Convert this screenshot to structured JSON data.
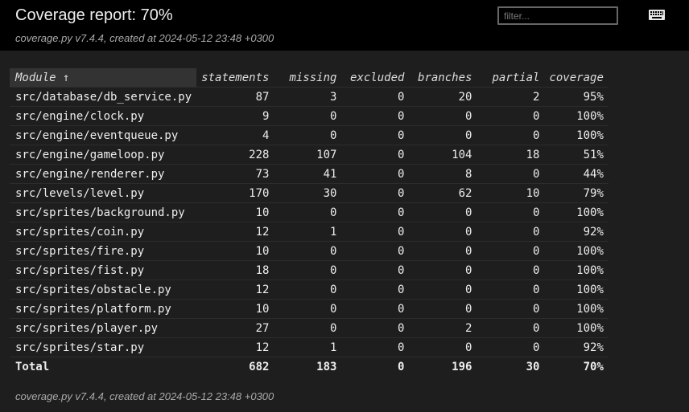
{
  "header": {
    "title": "Coverage report: 70%",
    "subtitle": "coverage.py v7.4.4, created at 2024-05-12 23:48 +0300",
    "filter_placeholder": "filter...",
    "keyboard_icon": "keyboard-icon"
  },
  "table": {
    "columns": [
      "Module ↑",
      "statements",
      "missing",
      "excluded",
      "branches",
      "partial",
      "coverage"
    ],
    "rows": [
      [
        "src/database/db_service.py",
        "87",
        "3",
        "0",
        "20",
        "2",
        "95%"
      ],
      [
        "src/engine/clock.py",
        "9",
        "0",
        "0",
        "0",
        "0",
        "100%"
      ],
      [
        "src/engine/eventqueue.py",
        "4",
        "0",
        "0",
        "0",
        "0",
        "100%"
      ],
      [
        "src/engine/gameloop.py",
        "228",
        "107",
        "0",
        "104",
        "18",
        "51%"
      ],
      [
        "src/engine/renderer.py",
        "73",
        "41",
        "0",
        "8",
        "0",
        "44%"
      ],
      [
        "src/levels/level.py",
        "170",
        "30",
        "0",
        "62",
        "10",
        "79%"
      ],
      [
        "src/sprites/background.py",
        "10",
        "0",
        "0",
        "0",
        "0",
        "100%"
      ],
      [
        "src/sprites/coin.py",
        "12",
        "1",
        "0",
        "0",
        "0",
        "92%"
      ],
      [
        "src/sprites/fire.py",
        "10",
        "0",
        "0",
        "0",
        "0",
        "100%"
      ],
      [
        "src/sprites/fist.py",
        "18",
        "0",
        "0",
        "0",
        "0",
        "100%"
      ],
      [
        "src/sprites/obstacle.py",
        "12",
        "0",
        "0",
        "0",
        "0",
        "100%"
      ],
      [
        "src/sprites/platform.py",
        "10",
        "0",
        "0",
        "0",
        "0",
        "100%"
      ],
      [
        "src/sprites/player.py",
        "27",
        "0",
        "0",
        "2",
        "0",
        "100%"
      ],
      [
        "src/sprites/star.py",
        "12",
        "1",
        "0",
        "0",
        "0",
        "92%"
      ]
    ],
    "total": [
      "Total",
      "682",
      "183",
      "0",
      "196",
      "30",
      "70%"
    ]
  },
  "footer": {
    "text": "coverage.py v7.4.4, created at 2024-05-12 23:48 +0300"
  },
  "colors": {
    "background": "#1e1e1e",
    "header_background": "#000000",
    "sorted_header": "#333333"
  }
}
